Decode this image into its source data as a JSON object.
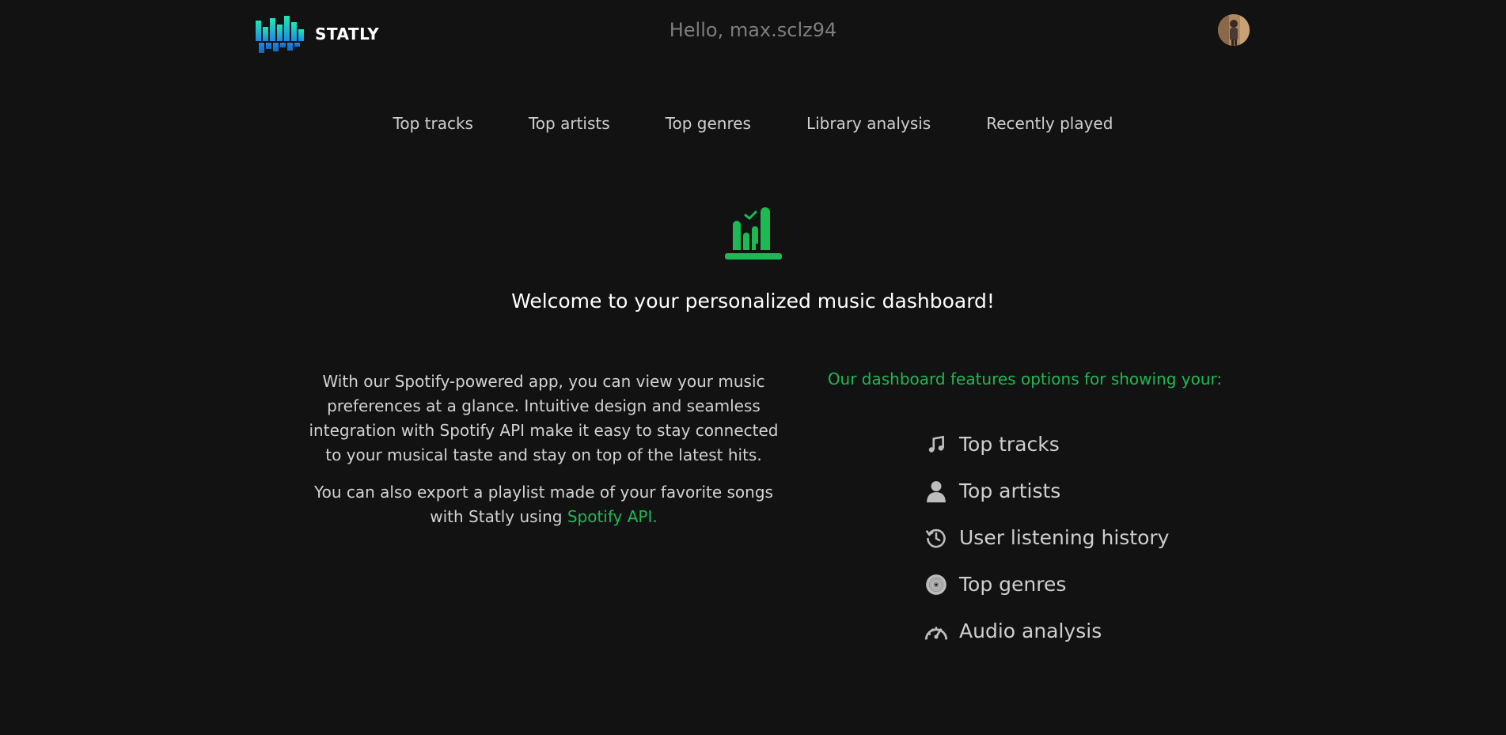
{
  "header": {
    "brand": "STATLY",
    "greeting": "Hello, max.sclz94"
  },
  "nav": {
    "items": [
      {
        "label": "Top tracks"
      },
      {
        "label": "Top artists"
      },
      {
        "label": "Top genres"
      },
      {
        "label": "Library analysis"
      },
      {
        "label": "Recently played"
      }
    ]
  },
  "main": {
    "welcome": "Welcome to your personalized music dashboard!",
    "paragraph1": "With our Spotify-powered app, you can view your music preferences at a glance. Intuitive design and seamless integration with Spotify API make it easy to stay connected to your musical taste and stay on top of the latest hits.",
    "paragraph2_prefix": "You can also export a playlist made of your favorite songs with Statly using ",
    "paragraph2_link": "Spotify API."
  },
  "features": {
    "intro": "Our dashboard features options for showing your:",
    "items": [
      {
        "label": "Top tracks",
        "icon": "music-note-icon"
      },
      {
        "label": "Top artists",
        "icon": "person-icon"
      },
      {
        "label": "User listening history",
        "icon": "history-icon"
      },
      {
        "label": "Top genres",
        "icon": "vinyl-icon"
      },
      {
        "label": "Audio analysis",
        "icon": "speedometer-icon"
      }
    ]
  },
  "colors": {
    "background": "#121212",
    "accent": "#1db954",
    "text": "#cfcfcf",
    "muted": "#7d7d7d"
  }
}
